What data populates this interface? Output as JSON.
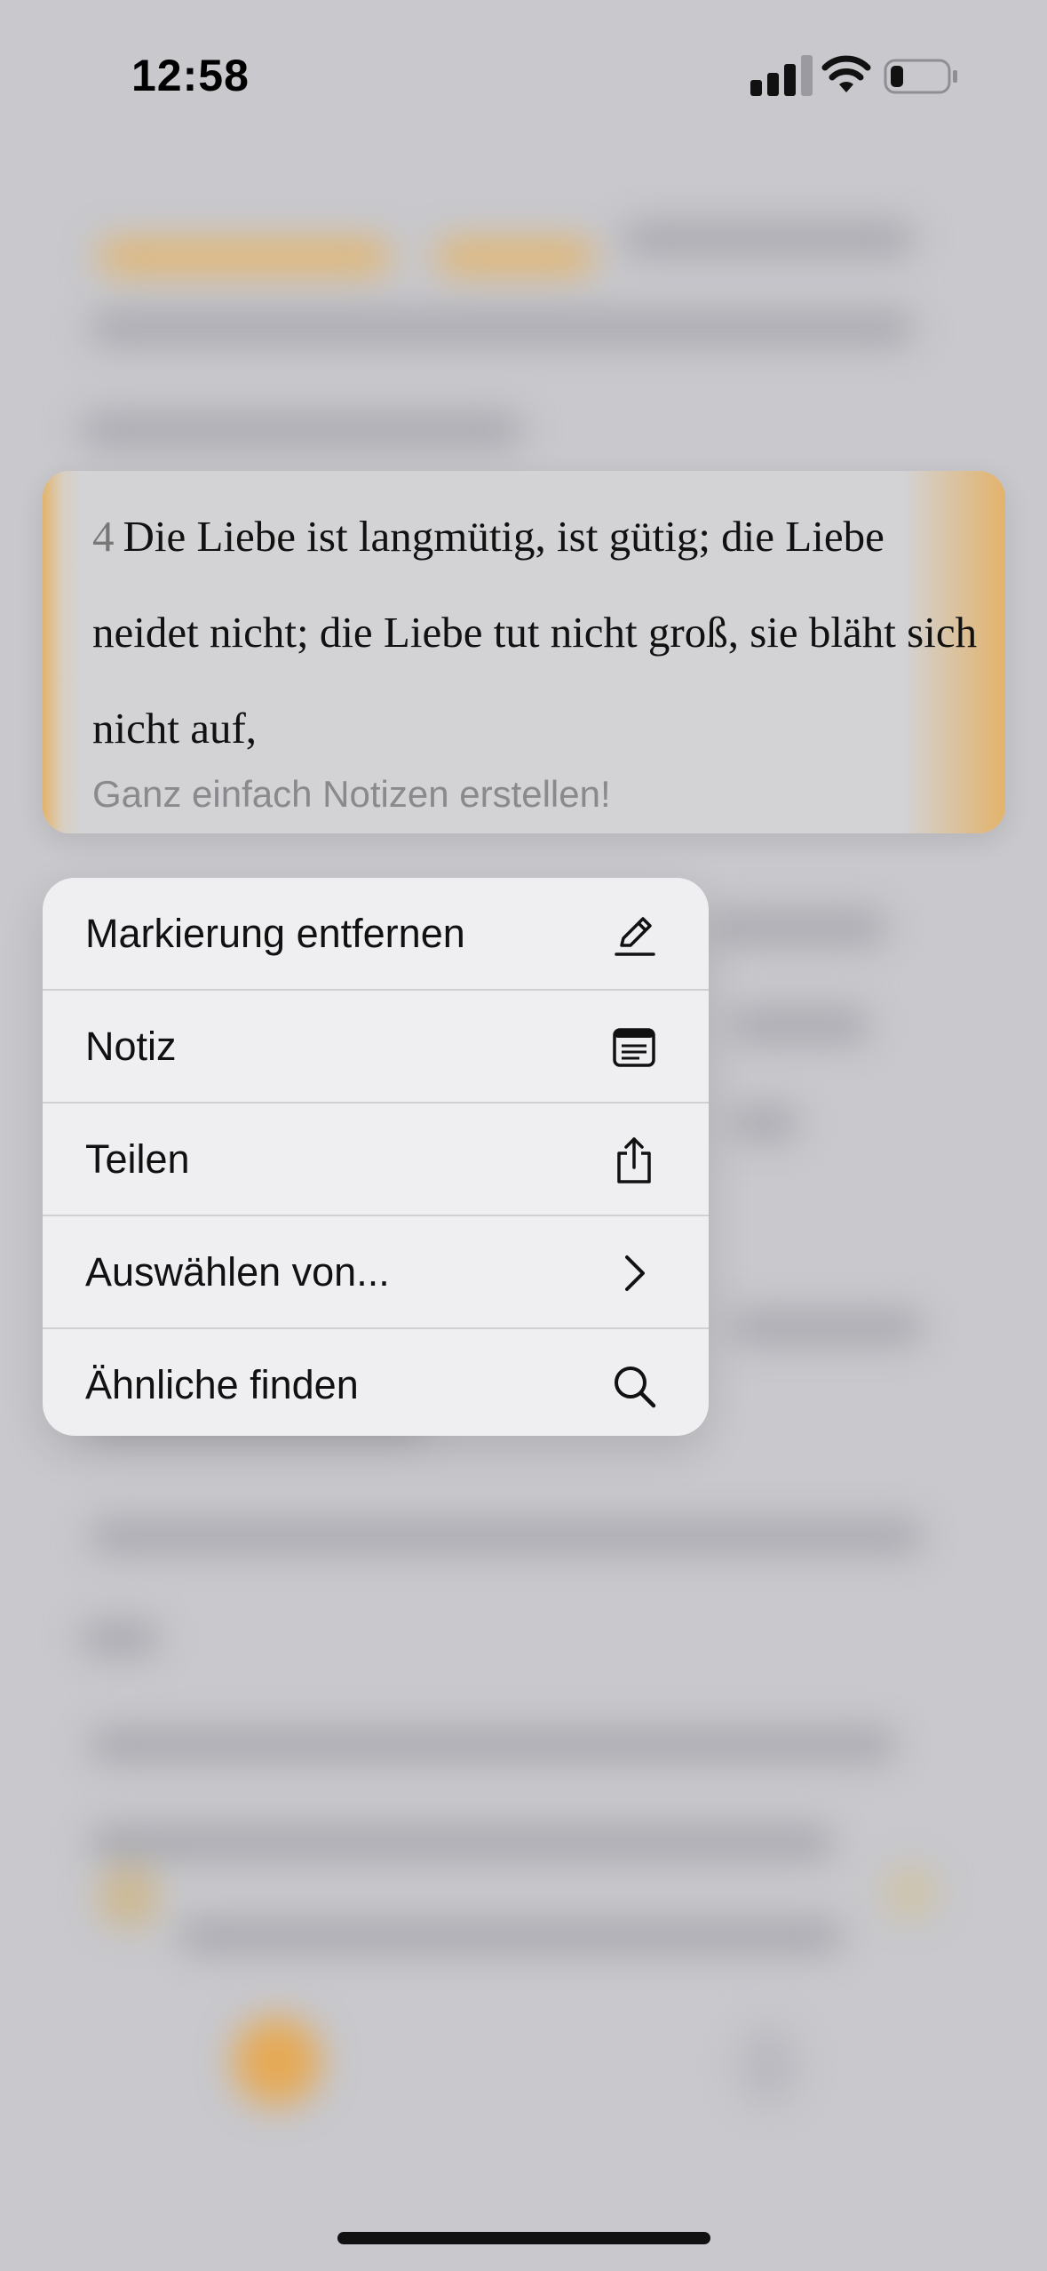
{
  "status_bar": {
    "time": "12:58"
  },
  "verse": {
    "number": "4",
    "text": "Die Liebe ist langmütig, ist gütig; die Liebe neidet nicht; die Liebe tut nicht groß, sie bläht sich nicht auf,",
    "note_prompt": "Ganz einfach Notizen erstellen!"
  },
  "context_menu": {
    "items": [
      {
        "label": "Markierung entfernen",
        "icon": "pencil-icon"
      },
      {
        "label": "Notiz",
        "icon": "note-icon"
      },
      {
        "label": "Teilen",
        "icon": "share-icon"
      },
      {
        "label": "Auswählen von...",
        "icon": "chevron-right-icon"
      },
      {
        "label": "Ähnliche finden",
        "icon": "search-icon"
      }
    ]
  },
  "colors": {
    "highlight": "#e3b36b",
    "menu_background": "#efeff2",
    "backdrop": "#c8c8cd"
  }
}
